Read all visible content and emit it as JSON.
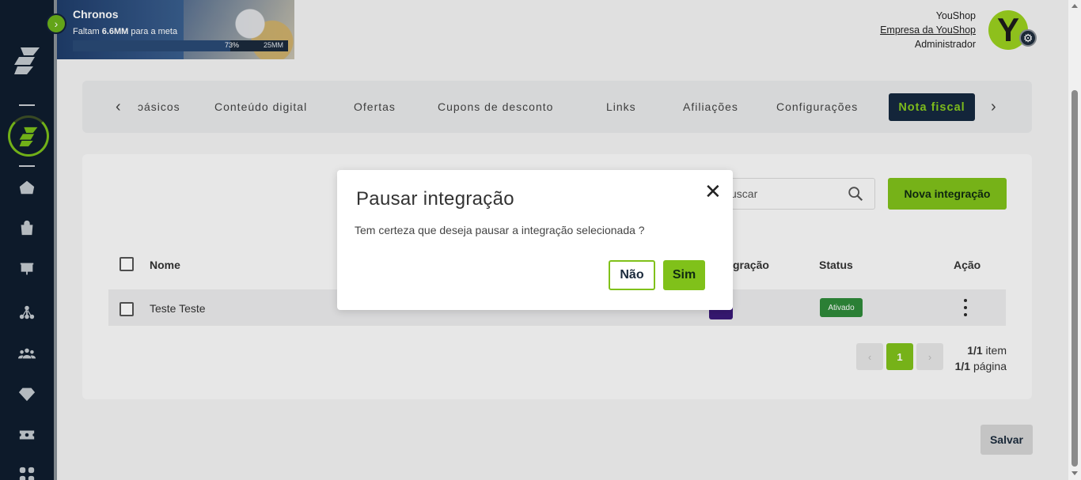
{
  "banner": {
    "title": "Chronos",
    "subtitle_prefix": "Faltam",
    "subtitle_amount": "6.6MM",
    "subtitle_suffix": "para a meta",
    "progress_label": "73%",
    "progress_value": 0.73,
    "goal_label": "25MM"
  },
  "user": {
    "name": "YouShop",
    "company": "Empresa da YouShop",
    "role": "Administrador",
    "avatar_letter": "Y"
  },
  "tabs": {
    "items": [
      "ɔásicos",
      "Conteúdo digital",
      "Ofertas",
      "Cupons de desconto",
      "Links",
      "Afiliações",
      "Configurações"
    ],
    "active": "Nota fiscal"
  },
  "toolbar": {
    "search_placeholder": "uscar",
    "new_button": "Nova integração"
  },
  "table": {
    "headers": {
      "name": "Nome",
      "integration": "gração",
      "status": "Status",
      "action": "Ação"
    },
    "rows": [
      {
        "name": "Teste Teste",
        "status": "Ativado"
      }
    ]
  },
  "pagination": {
    "current": "1",
    "items_count": "1/1",
    "items_label": "item",
    "pages_count": "1/1",
    "pages_label": "página"
  },
  "footer": {
    "save_label": "Salvar"
  },
  "modal": {
    "title": "Pausar integração",
    "close": "✕",
    "text": "Tem certeza que deseja pausar a integração selecionada ?",
    "no_label": "Não",
    "yes_label": "Sim"
  },
  "colors": {
    "accent": "#80c11a",
    "sidebar": "#0f1d2e",
    "active_tab": "#15283f",
    "status_active": "#2f8a3a"
  }
}
